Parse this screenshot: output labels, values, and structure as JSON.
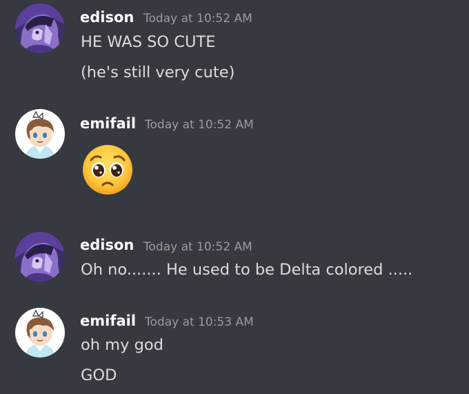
{
  "messages": [
    {
      "author": "edison",
      "timestamp": "Today at 10:52 AM",
      "lines": [
        "HE WAS SO CUTE",
        "(he's still very cute)"
      ]
    },
    {
      "author": "emifail",
      "timestamp": "Today at 10:52 AM",
      "emoji": "pleading-face-emoji"
    },
    {
      "author": "edison",
      "timestamp": "Today at 10:52 AM",
      "lines": [
        "Oh no....... He used to be Delta colored ....."
      ]
    },
    {
      "author": "emifail",
      "timestamp": "Today at 10:53 AM",
      "lines": [
        "oh my god",
        "GOD"
      ]
    }
  ],
  "colors": {
    "background": "#36393f",
    "username": "#ffffff",
    "timestamp": "#9a9ca2",
    "message_text": "#dcddde"
  }
}
